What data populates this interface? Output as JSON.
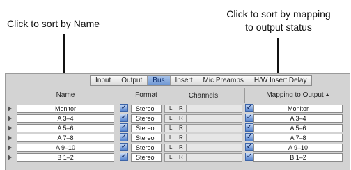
{
  "callouts": {
    "name": "Click to sort by Name",
    "mapping_line1": "Click to sort by mapping",
    "mapping_line2": "to output status"
  },
  "tabs": [
    {
      "label": "Input",
      "active": false
    },
    {
      "label": "Output",
      "active": false
    },
    {
      "label": "Bus",
      "active": true
    },
    {
      "label": "Insert",
      "active": false
    },
    {
      "label": "Mic Preamps",
      "active": false
    },
    {
      "label": "H/W Insert Delay",
      "active": false
    }
  ],
  "columns": {
    "name": "Name",
    "format": "Format",
    "channels": "Channels",
    "mapping": "Mapping to Output"
  },
  "rows": [
    {
      "name": "Monitor",
      "format": "Stereo",
      "ch_l": "L",
      "ch_r": "R",
      "mapping": "Monitor"
    },
    {
      "name": "A 3–4",
      "format": "Stereo",
      "ch_l": "L",
      "ch_r": "R",
      "mapping": "A 3–4"
    },
    {
      "name": "A 5–6",
      "format": "Stereo",
      "ch_l": "L",
      "ch_r": "R",
      "mapping": "A 5–6"
    },
    {
      "name": "A 7–8",
      "format": "Stereo",
      "ch_l": "L",
      "ch_r": "R",
      "mapping": "A 7–8"
    },
    {
      "name": "A 9–10",
      "format": "Stereo",
      "ch_l": "L",
      "ch_r": "R",
      "mapping": "A 9–10"
    },
    {
      "name": "B 1–2",
      "format": "Stereo",
      "ch_l": "L",
      "ch_r": "R",
      "mapping": "B 1–2"
    }
  ],
  "colors": {
    "active_tab": "#7fa2dc",
    "checkbox": "#4f7fcd",
    "window_bg": "#d3d3d3"
  },
  "icons": {
    "checkbox": "checkmark-icon",
    "sort": "sort-indicator-icon",
    "disclosure": "disclosure-triangle-icon"
  }
}
